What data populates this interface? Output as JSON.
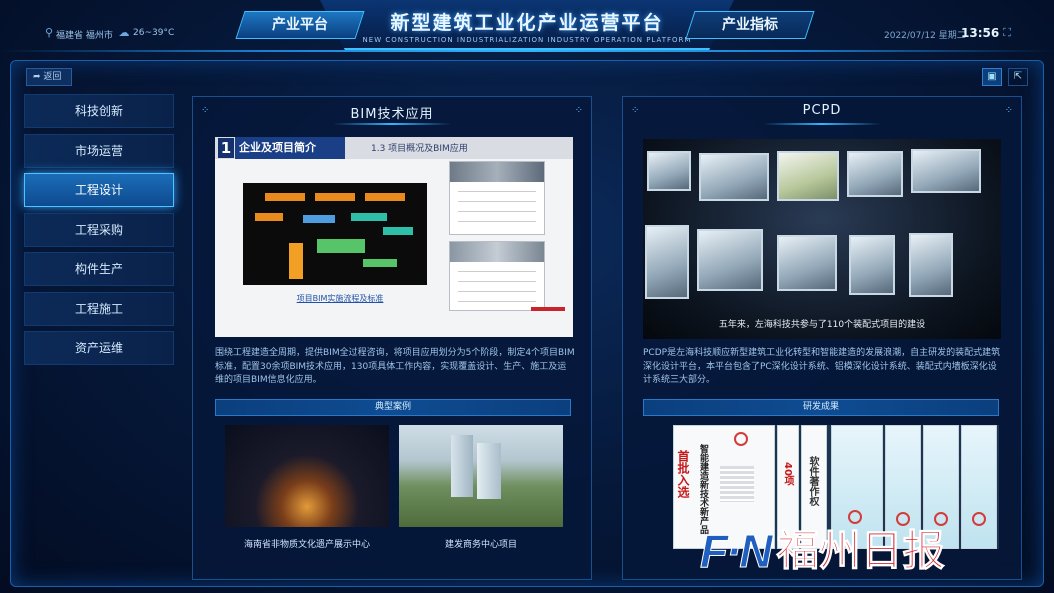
{
  "header": {
    "title": "新型建筑工业化产业运营平台",
    "subtitle": "NEW CONSTRUCTION INDUSTRIALIZATION INDUSTRY OPERATION PLATFORM",
    "tab_left": "产业平台",
    "tab_right": "产业指标",
    "location": "福建省 福州市",
    "weather": "26~39°C",
    "date": "2022/07/12 星期二",
    "time": "13:56"
  },
  "nav": {
    "back_label": "返回"
  },
  "sidebar": {
    "items": [
      {
        "label": "科技创新"
      },
      {
        "label": "市场运营"
      },
      {
        "label": "工程设计"
      },
      {
        "label": "工程采购"
      },
      {
        "label": "构件生产"
      },
      {
        "label": "工程施工"
      },
      {
        "label": "资产运维"
      }
    ],
    "active_index": 2
  },
  "left_panel": {
    "title": "BIM技术应用",
    "slide": {
      "number": "1",
      "heading": "企业及项目简介",
      "subheading": "1.3  项目概况及BIM应用",
      "caption": "项目BIM实施流程及标准"
    },
    "description": "围绕工程建造全周期，提供BIM全过程咨询，将项目应用划分为5个阶段，制定4个项目BIM标准，配置30余项BIM技术应用，130项具体工作内容，实现覆盖设计、生产、施工及运维的项目BIM信息化应用。",
    "cases_title": "典型案例",
    "cases": [
      {
        "caption": "海南省非物质文化遗产展示中心"
      },
      {
        "caption": "建发商务中心项目"
      }
    ]
  },
  "right_panel": {
    "title": "PCPD",
    "video_subtitle": "五年来，左海科技共参与了110个装配式项目的建设",
    "description": "PCDP是左海科技顺应新型建筑工业化转型和智能建造的发展浪潮，自主研发的装配式建筑深化设计平台，本平台包含了PC深化设计系统、铝模深化设计系统、装配式内墙板深化设计系统三大部分。",
    "results_title": "研发成果",
    "cert_text_1": "首批入选",
    "cert_text_2": "智能建造新技术新产品",
    "cert_text_3": "40项",
    "cert_text_4": "软件著作权"
  },
  "watermark": {
    "latin": "F·N",
    "chinese": "福州日报"
  },
  "colors": {
    "accent": "#36b6ff",
    "background": "#04102a",
    "active_item": "#1b6db8"
  }
}
